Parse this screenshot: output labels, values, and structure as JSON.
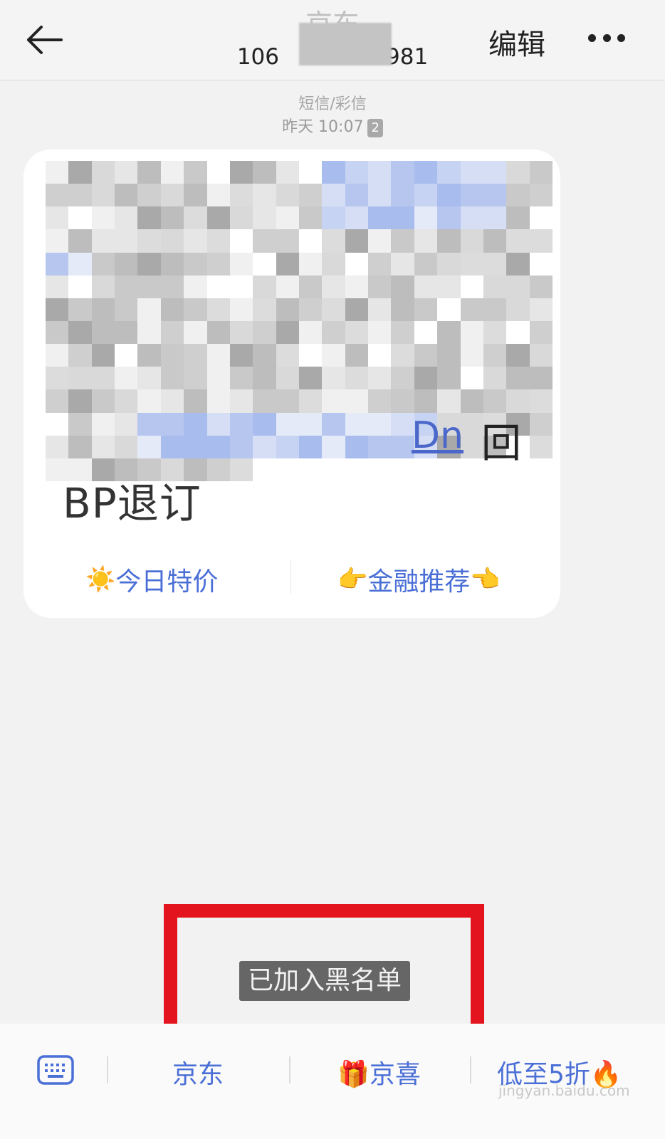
{
  "header": {
    "contact_name": "京东",
    "number_start": "106",
    "number_end": "981",
    "edit_label": "编辑",
    "more_icon": "more-icon",
    "back_icon": "arrow-left-icon"
  },
  "thread": {
    "type_label": "短信/彩信",
    "timestamp": "昨天 10:07",
    "sim_badge": "2"
  },
  "message": {
    "tail_link": "Dn",
    "tail_char": "回",
    "last_line": "BP退订",
    "quick_actions": [
      {
        "icon": "☀️",
        "label": "今日特价"
      },
      {
        "icon_left": "👉",
        "label": "金融推荐",
        "icon_right": "👈"
      }
    ]
  },
  "toast": {
    "text": "已加入黑名单",
    "highlight_color": "#e3141e"
  },
  "bottom_menu": {
    "keyboard_icon": "keyboard-icon",
    "items": [
      {
        "label": "京东"
      },
      {
        "icon": "🎁",
        "label": "京喜"
      },
      {
        "label": "低至5折",
        "icon": "🔥"
      }
    ]
  },
  "watermark": "jingyan.baidu.com",
  "colors": {
    "accent_blue": "#4a6fd6",
    "background": "#f2f2f2",
    "bubble": "#ffffff"
  }
}
